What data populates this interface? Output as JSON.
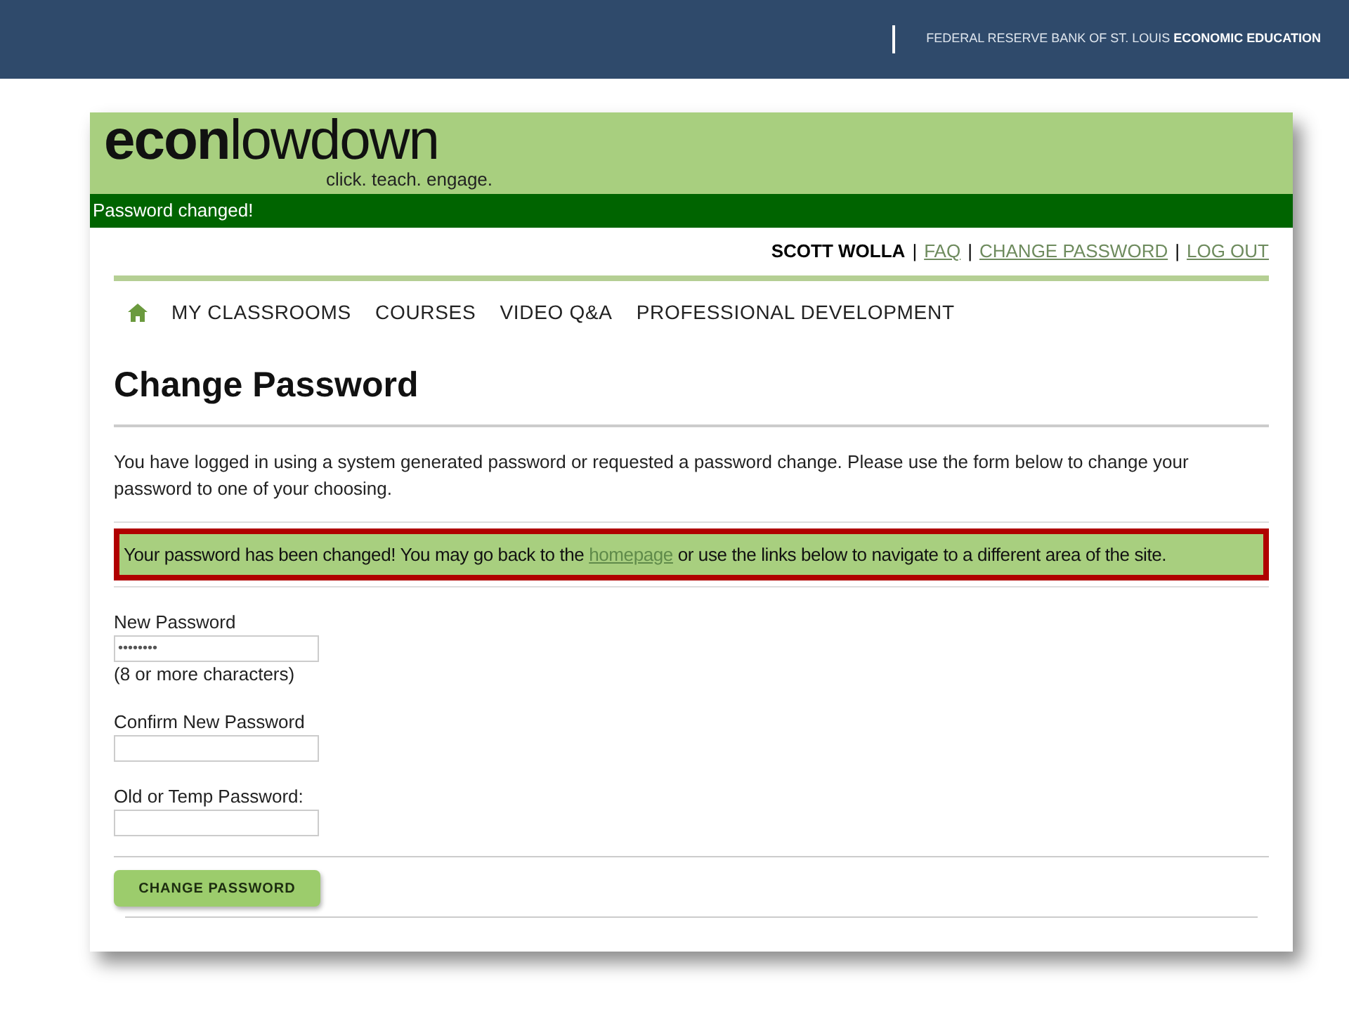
{
  "slide_header": {
    "org": "FEDERAL RESERVE BANK OF ST. LOUIS",
    "org_bold": "ECONOMIC EDUCATION"
  },
  "site": {
    "logo_bold": "econ",
    "logo_light": "lowdown",
    "tagline": "click. teach. engage."
  },
  "flash": "Password changed!",
  "user_bar": {
    "user": "SCOTT WOLLA",
    "separator": "|",
    "links": [
      "FAQ",
      "CHANGE PASSWORD",
      "LOG OUT"
    ]
  },
  "nav": [
    "MY CLASSROOMS",
    "COURSES",
    "VIDEO Q&A",
    "PROFESSIONAL DEVELOPMENT"
  ],
  "page_title": "Change Password",
  "intro": "You have logged in using a system generated password or requested a password change. Please use the form below to change your password to one of your choosing.",
  "notice": {
    "before": "Your password has been changed! You may go back to the ",
    "link": "homepage",
    "after": " or use the links below to navigate to a different area of the site."
  },
  "fields": [
    {
      "label": "New Password",
      "value": "••••••••",
      "hint": "(8 or more characters)"
    },
    {
      "label": "Confirm New Password"
    },
    {
      "label": "Old or Temp Password:"
    }
  ],
  "submit": "CHANGE PASSWORD"
}
